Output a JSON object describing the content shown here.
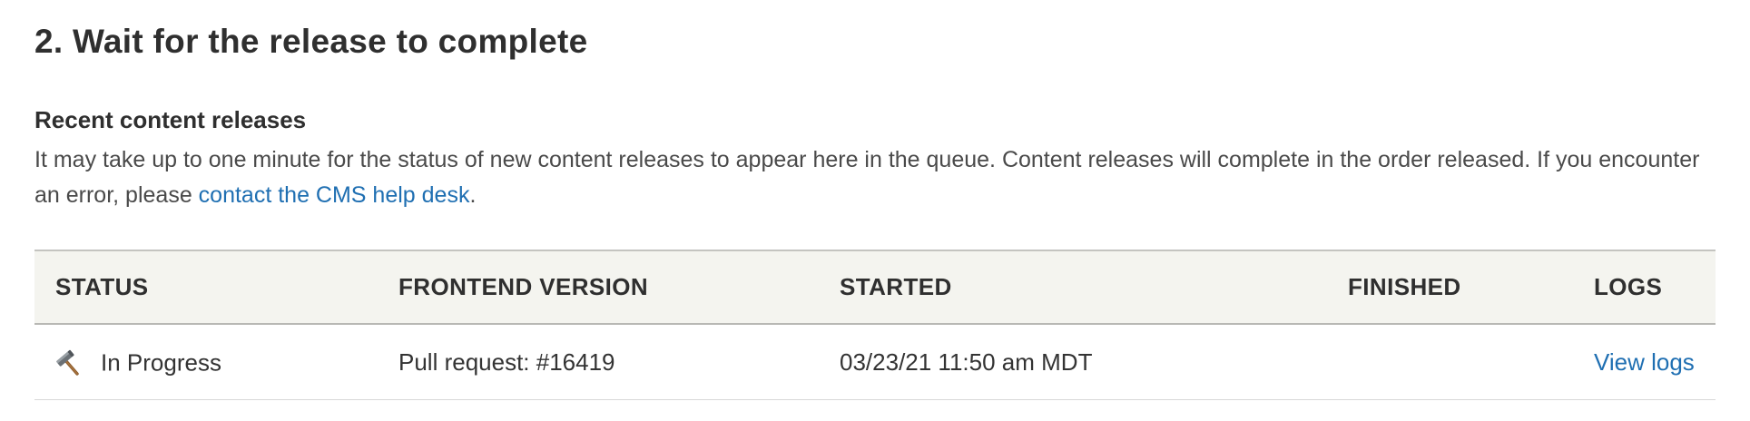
{
  "step_title": "2. Wait for the release to complete",
  "section_title": "Recent content releases",
  "description": {
    "text_before_link": "It may take up to one minute for the status of new content releases to appear here in the queue. Content releases will complete in the order released. If you encounter an error, please ",
    "link_text": "contact the CMS help desk",
    "text_after_link": "."
  },
  "table": {
    "headers": {
      "status": "STATUS",
      "frontend_version": "FRONTEND VERSION",
      "started": "STARTED",
      "finished": "FINISHED",
      "logs": "LOGS"
    },
    "rows": [
      {
        "status_icon": "hammer-icon",
        "status": "In Progress",
        "frontend_version": "Pull request: #16419",
        "started": "03/23/21 11:50 am MDT",
        "finished": "",
        "logs_link": "View logs"
      }
    ]
  },
  "colors": {
    "link": "#1f6fb2",
    "header_background": "#f4f4ef",
    "text": "#333333"
  }
}
